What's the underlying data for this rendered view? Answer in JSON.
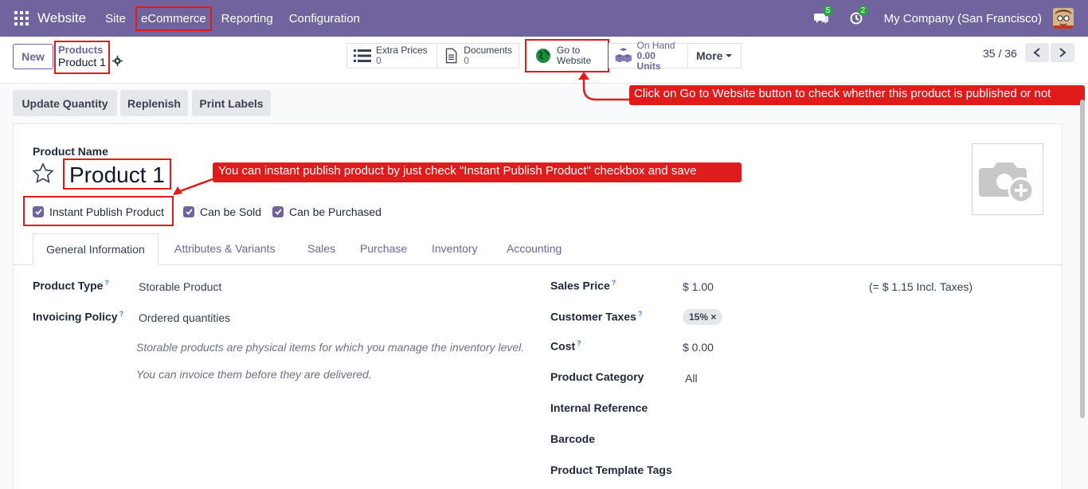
{
  "navbar": {
    "brand": "Website",
    "menu": [
      "Site",
      "eCommerce",
      "Reporting",
      "Configuration"
    ],
    "messages_count": "5",
    "activities_count": "2",
    "company": "My Company (San Francisco)"
  },
  "control": {
    "new_label": "New",
    "breadcrumb_parent": "Products",
    "breadcrumb_current": "Product 1",
    "smart_buttons": {
      "extra_prices_label": "Extra Prices",
      "extra_prices_value": "0",
      "documents_label": "Documents",
      "documents_value": "0",
      "go_to_label1": "Go to",
      "go_to_label2": "Website",
      "on_hand_label": "On Hand",
      "on_hand_value": "0.00 Units",
      "more_label": "More"
    },
    "pager": "35 / 36"
  },
  "actions": [
    "Update Quantity",
    "Replenish",
    "Print Labels"
  ],
  "form": {
    "product_name_label": "Product Name",
    "product_name": "Product 1",
    "checkboxes": [
      "Instant Publish Product",
      "Can be Sold",
      "Can be Purchased"
    ],
    "tabs": [
      "General Information",
      "Attributes & Variants",
      "Sales",
      "Purchase",
      "Inventory",
      "Accounting"
    ],
    "left_fields": {
      "product_type_label": "Product Type",
      "product_type_value": "Storable Product",
      "invoicing_policy_label": "Invoicing Policy",
      "invoicing_policy_value": "Ordered quantities",
      "hint1": "Storable products are physical items for which you manage the inventory level.",
      "hint2": "You can invoice them before they are delivered."
    },
    "right_fields": {
      "sales_price_label": "Sales Price",
      "sales_price_value": "$ 1.00",
      "incl_taxes": "(= $ 1.15 Incl. Taxes)",
      "customer_taxes_label": "Customer Taxes",
      "tax_tag": "15%",
      "cost_label": "Cost",
      "cost_value": "$ 0.00",
      "category_label": "Product Category",
      "category_value": "All",
      "internal_ref_label": "Internal Reference",
      "barcode_label": "Barcode",
      "template_tags_label": "Product Template Tags"
    }
  },
  "callouts": {
    "go_to_website": "Click on Go to Website button to check whether this product is published or not",
    "instant_publish": "You can instant publish product by just check \"Instant Publish Product\" checkbox and save"
  },
  "colors": {
    "brand": "#71639e",
    "annotation": "#e01b1b"
  }
}
